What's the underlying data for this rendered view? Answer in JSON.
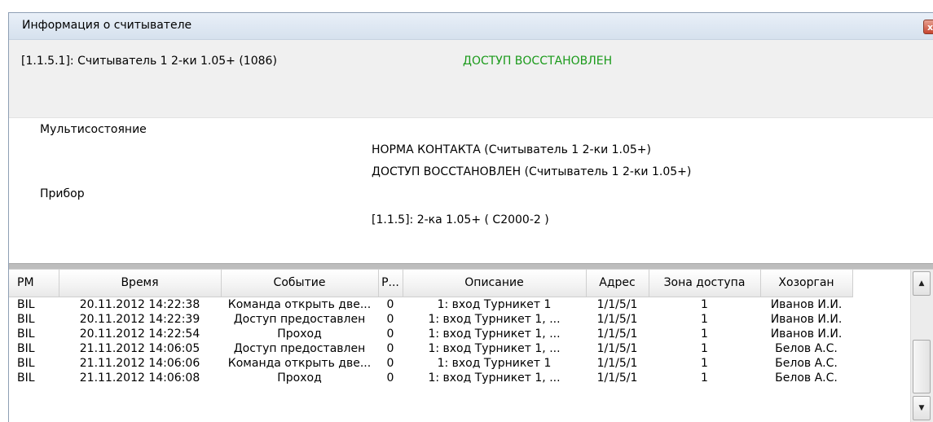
{
  "window": {
    "title": "Информация о считывателе",
    "close_label": "x"
  },
  "reader": {
    "name": "[1.1.5.1]: Считыватель 1 2-ки 1.05+ (1086)",
    "status": "ДОСТУП ВОССТАНОВЛЕН",
    "status_color": "#1a9a1a"
  },
  "info": {
    "multistate_label": "Мультисостояние",
    "multistate_values": [
      "НОРМА КОНТАКТА (Считыватель 1 2-ки 1.05+)",
      "ДОСТУП ВОССТАНОВЛЕН (Считыватель 1 2-ки 1.05+)"
    ],
    "device_label": "Прибор",
    "device_value": "[1.1.5]: 2-ка 1.05+ ( С2000-2 )"
  },
  "table": {
    "columns": [
      "РМ",
      "Время",
      "Событие",
      "Р...",
      "Описание",
      "Адрес",
      "Зона доступа",
      "Хозорган"
    ],
    "rows": [
      [
        "BIL",
        "20.11.2012 14:22:38",
        "Команда открыть две...",
        "0",
        "1: вход   Турникет 1",
        "1/1/5/1",
        "1",
        "Иванов И.И."
      ],
      [
        "BIL",
        "20.11.2012 14:22:39",
        "Доступ предоставлен",
        "0",
        "1: вход   Турникет 1, ...",
        "1/1/5/1",
        "1",
        "Иванов И.И."
      ],
      [
        "BIL",
        "20.11.2012 14:22:54",
        "Проход",
        "0",
        "1: вход   Турникет 1, ...",
        "1/1/5/1",
        "1",
        "Иванов И.И."
      ],
      [
        "BIL",
        "21.11.2012 14:06:05",
        "Доступ предоставлен",
        "0",
        "1: вход   Турникет 1, ...",
        "1/1/5/1",
        "1",
        "Белов А.С."
      ],
      [
        "BIL",
        "21.11.2012 14:06:06",
        "Команда открыть две...",
        "0",
        "1: вход   Турникет 1",
        "1/1/5/1",
        "1",
        "Белов А.С."
      ],
      [
        "BIL",
        "21.11.2012 14:06:08",
        "Проход",
        "0",
        "1: вход   Турникет 1, ...",
        "1/1/5/1",
        "1",
        "Белов А.С."
      ]
    ]
  },
  "scrollbar": {
    "up_icon": "▲",
    "down_icon": "▼"
  }
}
